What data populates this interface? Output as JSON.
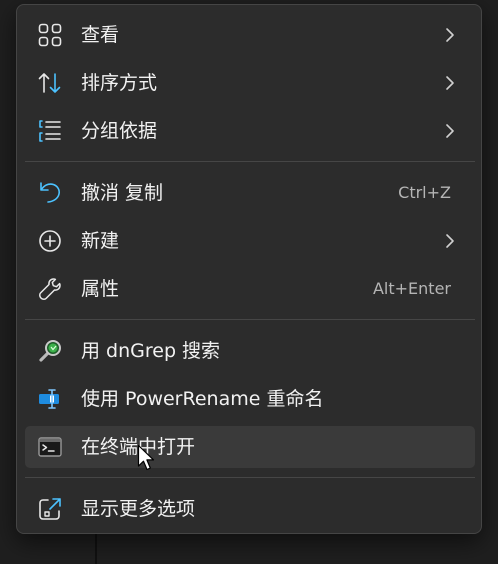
{
  "menu": {
    "groups": [
      {
        "items": [
          {
            "label": "查看",
            "icon": "grid-icon",
            "has_submenu": true
          },
          {
            "label": "排序方式",
            "icon": "sort-arrows-icon",
            "has_submenu": true
          },
          {
            "label": "分组依据",
            "icon": "group-list-icon",
            "has_submenu": true
          }
        ]
      },
      {
        "items": [
          {
            "label": "撤消 复制",
            "icon": "undo-icon",
            "shortcut": "Ctrl+Z"
          },
          {
            "label": "新建",
            "icon": "plus-circle-icon",
            "has_submenu": true
          },
          {
            "label": "属性",
            "icon": "wrench-icon",
            "shortcut": "Alt+Enter"
          }
        ]
      },
      {
        "items": [
          {
            "label": "用 dnGrep 搜索",
            "icon": "magnifier-icon"
          },
          {
            "label": "使用 PowerRename 重命名",
            "icon": "rename-icon"
          },
          {
            "label": "在终端中打开",
            "icon": "terminal-icon",
            "hovered": true
          }
        ]
      },
      {
        "items": [
          {
            "label": "显示更多选项",
            "icon": "open-external-icon"
          }
        ]
      }
    ]
  },
  "colors": {
    "menu_background": "#2c2c2c",
    "hover_background": "#3a3a3a",
    "text": "#f2f2f2",
    "shortcut_text": "#b5b5b5",
    "accent": "#4cc2ff"
  }
}
